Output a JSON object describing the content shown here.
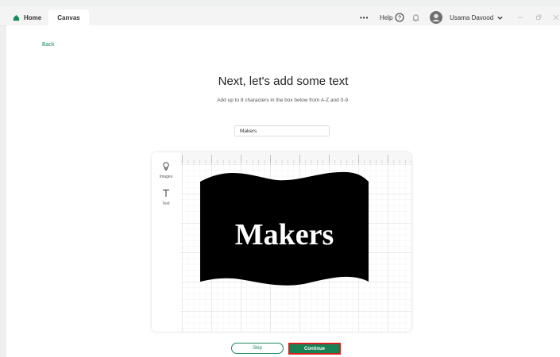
{
  "titlebar": {
    "tabs": [
      {
        "label": "Home",
        "icon": "home-icon"
      },
      {
        "label": "Canvas"
      }
    ],
    "more_label": "•••",
    "help_label": "Help",
    "user_name": "Usama Davood",
    "window_controls": [
      "minimize-icon",
      "restore-icon",
      "close-icon"
    ]
  },
  "page": {
    "back_label": "Back",
    "title": "Next, let's add some text",
    "subtitle": "Add up to 8 characters in the box below from A-Z and 0-9.",
    "input_value": "Makers"
  },
  "editor": {
    "tools": [
      {
        "label": "Images",
        "icon": "lightbulb-icon"
      },
      {
        "label": "Text",
        "icon": "text-T-icon"
      }
    ],
    "preview_text": "Makers"
  },
  "actions": {
    "skip_label": "Skip",
    "continue_label": "Continue"
  },
  "colors": {
    "brand_green": "#188254",
    "highlight_red": "#d61f1f",
    "shape_fill": "#000000"
  }
}
